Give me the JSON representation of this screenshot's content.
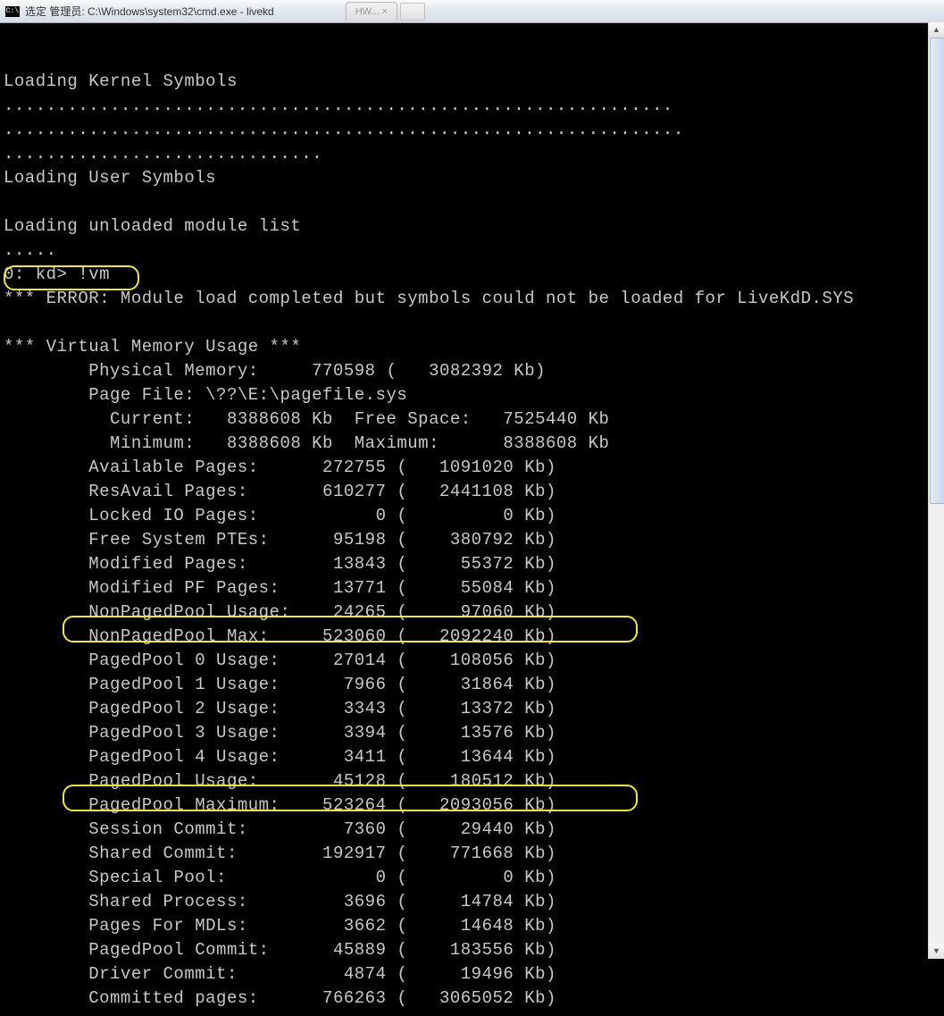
{
  "titlebar": {
    "icon_label": "C:\\",
    "title": "选定 管理员: C:\\Windows\\system32\\cmd.exe - livekd",
    "ghost_tab": "HW... ×"
  },
  "console": {
    "header_lines": [
      "",
      "Loading Kernel Symbols",
      "...............................................................",
      "................................................................",
      "..............................",
      "Loading User Symbols",
      "",
      "Loading unloaded module list",
      "....."
    ],
    "prompt": "0: kd> !vm",
    "error_line": "*** ERROR: Module load completed but symbols could not be loaded for LiveKdD.SYS",
    "section_header": "*** Virtual Memory Usage ***",
    "phys_mem": "\tPhysical Memory:     770598 (   3082392 Kb)",
    "pagefile": "\tPage File: \\??\\E:\\pagefile.sys",
    "pf_current": "\t  Current:   8388608 Kb  Free Space:   7525440 Kb",
    "pf_minimum": "\t  Minimum:   8388608 Kb  Maximum:      8388608 Kb",
    "rows": [
      {
        "label": "Available Pages:",
        "pages": "272755",
        "kb": "1091020"
      },
      {
        "label": "ResAvail Pages:",
        "pages": "610277",
        "kb": "2441108"
      },
      {
        "label": "Locked IO Pages:",
        "pages": "0",
        "kb": "0"
      },
      {
        "label": "Free System PTEs:",
        "pages": "95198",
        "kb": "380792"
      },
      {
        "label": "Modified Pages:",
        "pages": "13843",
        "kb": "55372"
      },
      {
        "label": "Modified PF Pages:",
        "pages": "13771",
        "kb": "55084"
      },
      {
        "label": "NonPagedPool Usage:",
        "pages": "24265",
        "kb": "97060"
      },
      {
        "label": "NonPagedPool Max:",
        "pages": "523060",
        "kb": "2092240"
      },
      {
        "label": "PagedPool 0 Usage:",
        "pages": "27014",
        "kb": "108056"
      },
      {
        "label": "PagedPool 1 Usage:",
        "pages": "7966",
        "kb": "31864"
      },
      {
        "label": "PagedPool 2 Usage:",
        "pages": "3343",
        "kb": "13372"
      },
      {
        "label": "PagedPool 3 Usage:",
        "pages": "3394",
        "kb": "13576"
      },
      {
        "label": "PagedPool 4 Usage:",
        "pages": "3411",
        "kb": "13644"
      },
      {
        "label": "PagedPool Usage:",
        "pages": "45128",
        "kb": "180512"
      },
      {
        "label": "PagedPool Maximum:",
        "pages": "523264",
        "kb": "2093056"
      },
      {
        "label": "Session Commit:",
        "pages": "7360",
        "kb": "29440"
      },
      {
        "label": "Shared Commit:",
        "pages": "192917",
        "kb": "771668"
      },
      {
        "label": "Special Pool:",
        "pages": "0",
        "kb": "0"
      },
      {
        "label": "Shared Process:",
        "pages": "3696",
        "kb": "14784"
      },
      {
        "label": "Pages For MDLs:",
        "pages": "3662",
        "kb": "14648"
      },
      {
        "label": "PagedPool Commit:",
        "pages": "45889",
        "kb": "183556"
      },
      {
        "label": "Driver Commit:",
        "pages": "4874",
        "kb": "19496"
      },
      {
        "label": "Committed pages:",
        "pages": "766263",
        "kb": "3065052"
      }
    ]
  }
}
